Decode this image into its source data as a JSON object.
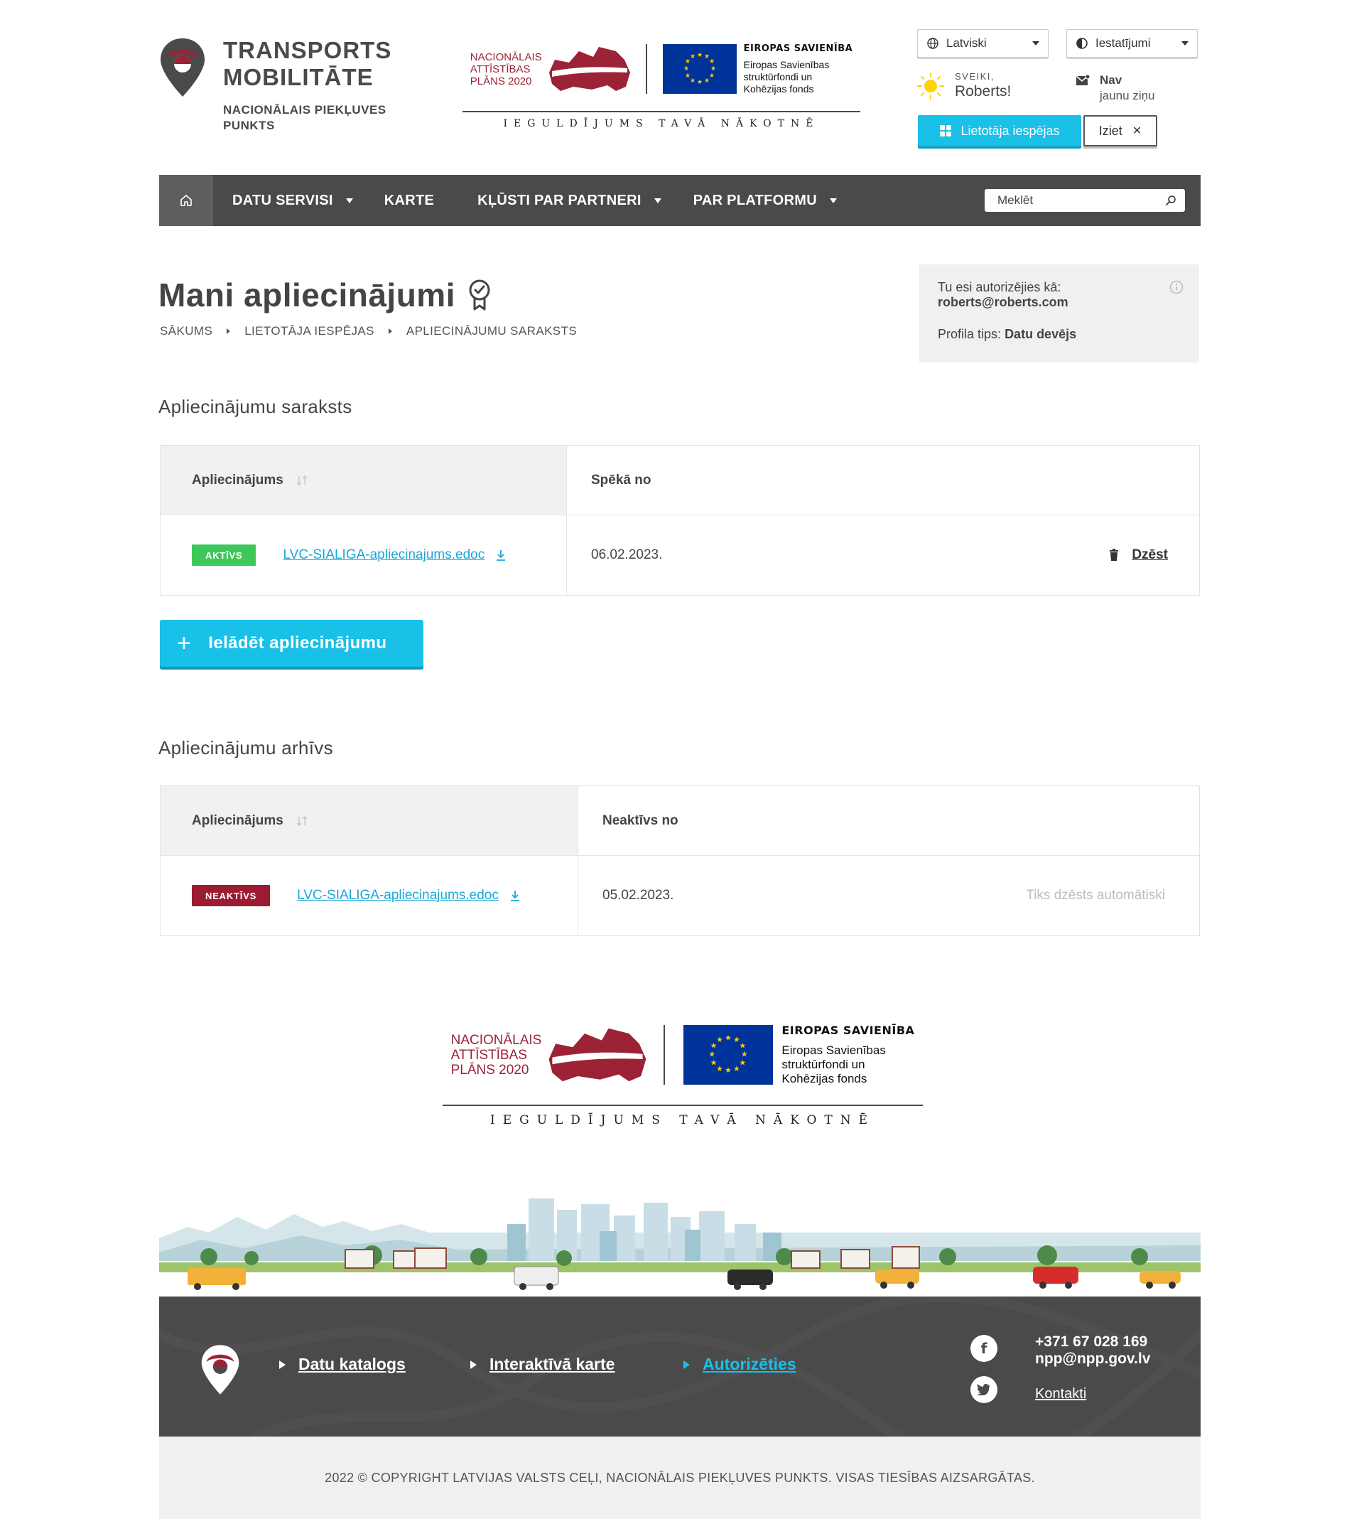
{
  "header": {
    "logo": {
      "title_line1": "TRANSPORTS",
      "title_line2": "MOBILITĀTE",
      "subtitle_line1": "NACIONĀLAIS PIEKĻUVES",
      "subtitle_line2": "PUNKTS"
    },
    "eu_banner": {
      "nap_line1": "NACIONĀLAIS",
      "nap_line2": "ATTĪSTĪBAS",
      "nap_line3": "PLĀNS 2020",
      "eu_title": "EIROPAS SAVIENĪBA",
      "eu_line1": "Eiropas Savienības",
      "eu_line2": "struktūrfondi un",
      "eu_line3": "Kohēzijas fonds",
      "slogan": "IEGULDĪJUMS TAVĀ NĀKOTNĒ"
    },
    "language_select": {
      "value": "Latviski",
      "icon": "globe-icon"
    },
    "settings_select": {
      "value": "Iestatījumi",
      "icon": "contrast-icon"
    },
    "greeting": {
      "small": "SVEIKI,",
      "name": "Roberts!"
    },
    "messages": {
      "line1": "Nav",
      "line2": "jaunu ziņu"
    },
    "user_options_button": "Lietotāja iespējas",
    "logout_button": "Iziet"
  },
  "nav": {
    "items": [
      {
        "label": "DATU SERVISI",
        "has_dropdown": true
      },
      {
        "label": "KARTE",
        "has_dropdown": false
      },
      {
        "label": "KĻŪSTI PAR PARTNERI",
        "has_dropdown": true
      },
      {
        "label": "PAR PLATFORMU",
        "has_dropdown": true
      }
    ],
    "search_placeholder": "Meklēt"
  },
  "page": {
    "title": "Mani apliecinājumi",
    "breadcrumb": [
      "SĀKUMS",
      "LIETOTĀJA IESPĒJAS",
      "APLIECINĀJUMU SARAKSTS"
    ],
    "auth": {
      "label": "Tu esi autorizējies kā:",
      "email": "roberts@roberts.com",
      "profile_label": "Profila tips:",
      "profile_value": "Datu devējs"
    }
  },
  "list": {
    "title": "Apliecinājumu saraksts",
    "col1": "Apliecinājums",
    "col2": "Spēkā no",
    "rows": [
      {
        "status": "AKTĪVS",
        "file": "LVC-SIALIGA-apliecinajums.edoc",
        "date": "06.02.2023.",
        "action": "Dzēst"
      }
    ],
    "upload_button": "Ielādēt apliecinājumu"
  },
  "archive": {
    "title": "Apliecinājumu arhīvs",
    "col1": "Apliecinājums",
    "col2": "Neaktīvs no",
    "rows": [
      {
        "status": "NEAKTĪVS",
        "file": "LVC-SIALIGA-apliecinajums.edoc",
        "date": "05.02.2023.",
        "note": "Tiks dzēsts automātiski"
      }
    ]
  },
  "footer": {
    "links": [
      "Datu katalogs",
      "Interaktīvā karte",
      "Autorizēties"
    ],
    "phone": "+371 67 028 169",
    "email": "npp@npp.gov.lv",
    "contacts_link": "Kontakti",
    "copyright": "2022 © COPYRIGHT LATVIJAS VALSTS CEĻI, NACIONĀLAIS PIEKĻUVES PUNKTS. VISAS TIESĪBAS AIZSARGĀTAS."
  },
  "colors": {
    "accent": "#19c0e8",
    "brand_red": "#9b1c32",
    "active_green": "#3fc85a",
    "nav_bg": "#4a4a4a"
  }
}
